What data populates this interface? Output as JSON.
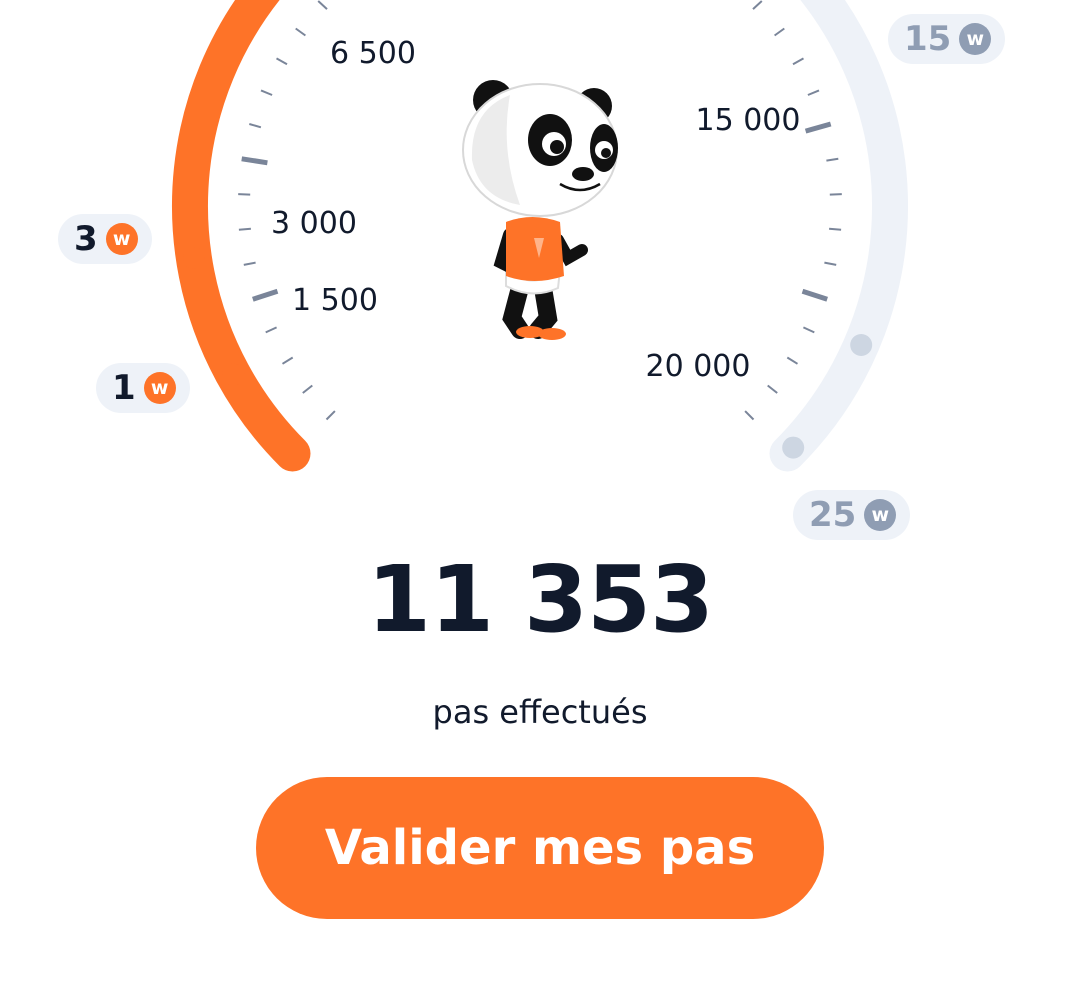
{
  "gauge": {
    "tick_labels": [
      "1 500",
      "3 000",
      "6 500",
      "15 000",
      "20 000"
    ],
    "progress_fraction": 0.5,
    "colors": {
      "progress": "#fe7328",
      "track": "#eef2f8",
      "tick": "#7a8599",
      "inactive_dot": "#cdd6e2"
    }
  },
  "rewards": [
    {
      "value": "1",
      "coin_letter": "w",
      "state": "reached"
    },
    {
      "value": "3",
      "coin_letter": "w",
      "state": "reached"
    },
    {
      "value": "15",
      "coin_letter": "w",
      "state": "locked"
    },
    {
      "value": "25",
      "coin_letter": "w",
      "state": "locked"
    }
  ],
  "mascot": {
    "name": "panda-mascot-icon"
  },
  "steps": {
    "count": "11 353",
    "caption": "pas effectués"
  },
  "action": {
    "label": "Valider mes pas"
  },
  "colors": {
    "accent": "#fe7328",
    "text": "#111a2c",
    "muted": "#8f9db3"
  }
}
